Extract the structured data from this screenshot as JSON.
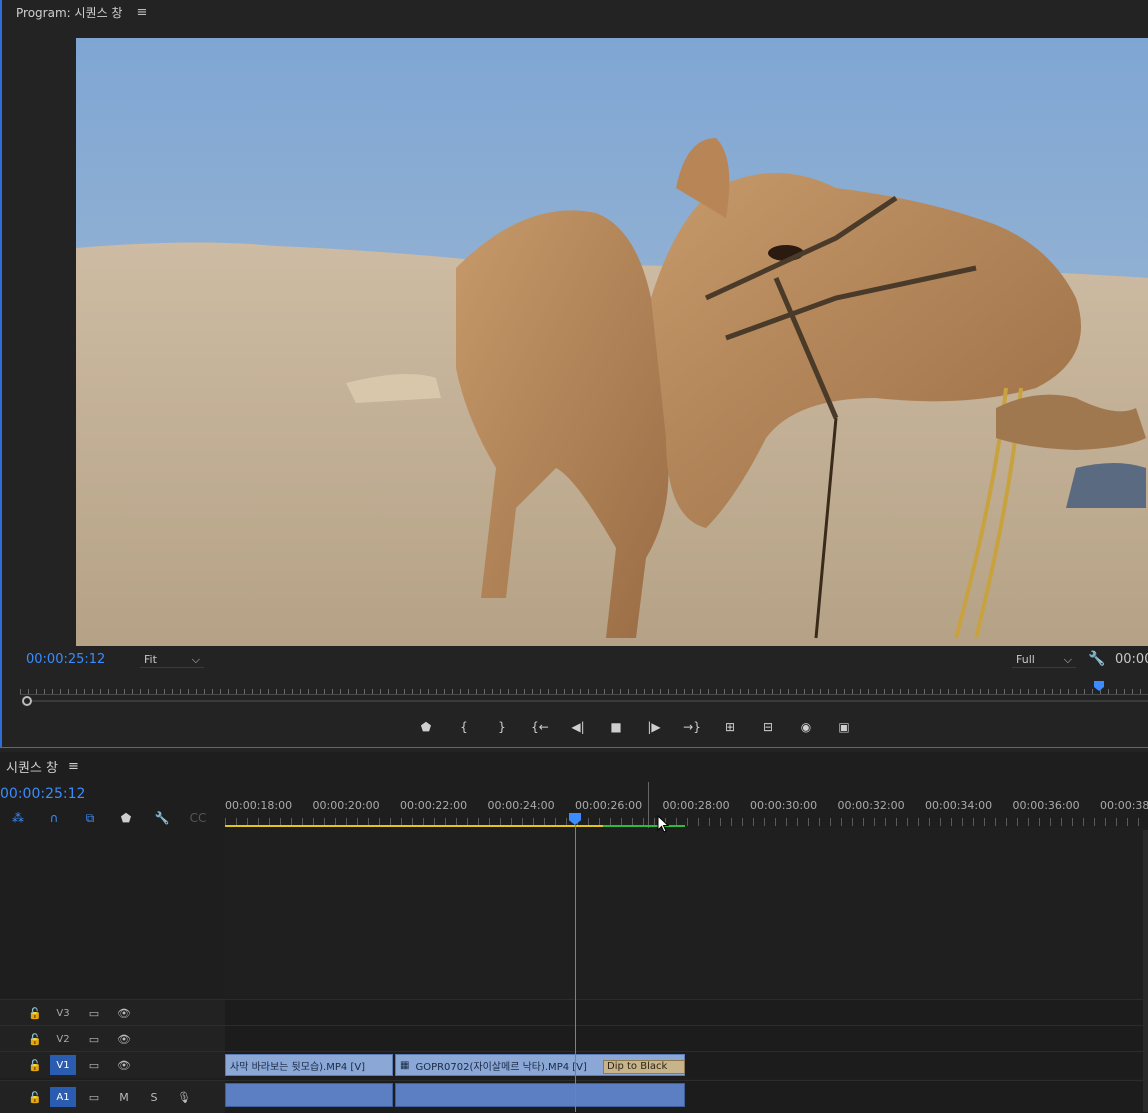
{
  "program": {
    "title": "Program: 시퀀스 창",
    "menu_icon": "≡",
    "timecode": "00:00:25:12",
    "fit": "Fit",
    "quality": "Full",
    "timecode_right": "00:00"
  },
  "transport": {
    "icons": [
      "marker-icon",
      "mark-in-icon",
      "mark-out-icon",
      "go-to-in-icon",
      "step-back-icon",
      "stop-icon",
      "step-forward-icon",
      "go-to-out-icon",
      "lift-icon",
      "extract-icon",
      "export-frame-icon",
      "compare-icon"
    ]
  },
  "sequence": {
    "title": "시퀀스 창",
    "menu_icon": "≡",
    "timecode": "00:00:25:12",
    "ruler_labels": [
      "00:00:18:00",
      "00:00:20:00",
      "00:00:22:00",
      "00:00:24:00",
      "00:00:26:00",
      "00:00:28:00",
      "00:00:30:00",
      "00:00:32:00",
      "00:00:34:00",
      "00:00:36:00",
      "00:00:38:"
    ],
    "tracks": [
      {
        "name": "V3"
      },
      {
        "name": "V2"
      },
      {
        "name": "V1"
      },
      {
        "name": "A1",
        "m": "M",
        "s": "S"
      }
    ],
    "clips": {
      "clip1": "사막 바라보는 뒷모습).MP4 [V]",
      "clip2": "GOPR0702(자이살메르 낙타).MP4 [V]",
      "transition": "Dip to Black"
    }
  },
  "colors": {
    "accent": "#3a8cff",
    "work_area": "#e6c51a",
    "rendered": "#2ebd3a",
    "clip": "#8aa7d6"
  }
}
